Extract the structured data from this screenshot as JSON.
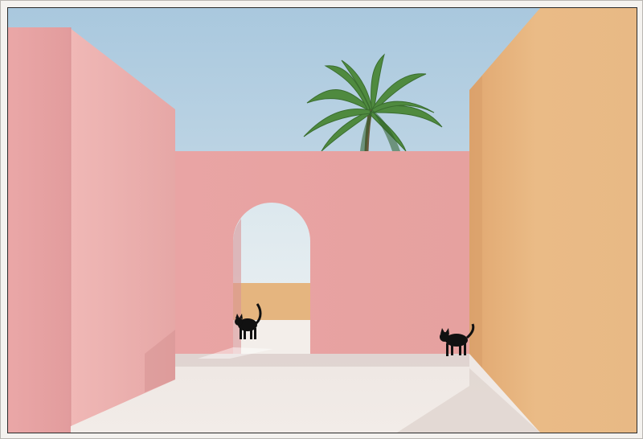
{
  "image": {
    "description": "",
    "palette": {
      "sky_top": "#a9c8de",
      "sky_bottom": "#dfe9ee",
      "pink_wall": "#e9a6a6",
      "pink_wall_shadow": "#d78f90",
      "pink_wall_light": "#f0b9b7",
      "peach_wall": "#e9b882",
      "peach_wall_dark": "#d9a06c",
      "floor": "#efe8e4",
      "floor_shadow": "#d8c9c6",
      "palm_green": "#4f8a3f",
      "palm_dark": "#2f5f2a",
      "cat": "#111111"
    }
  }
}
